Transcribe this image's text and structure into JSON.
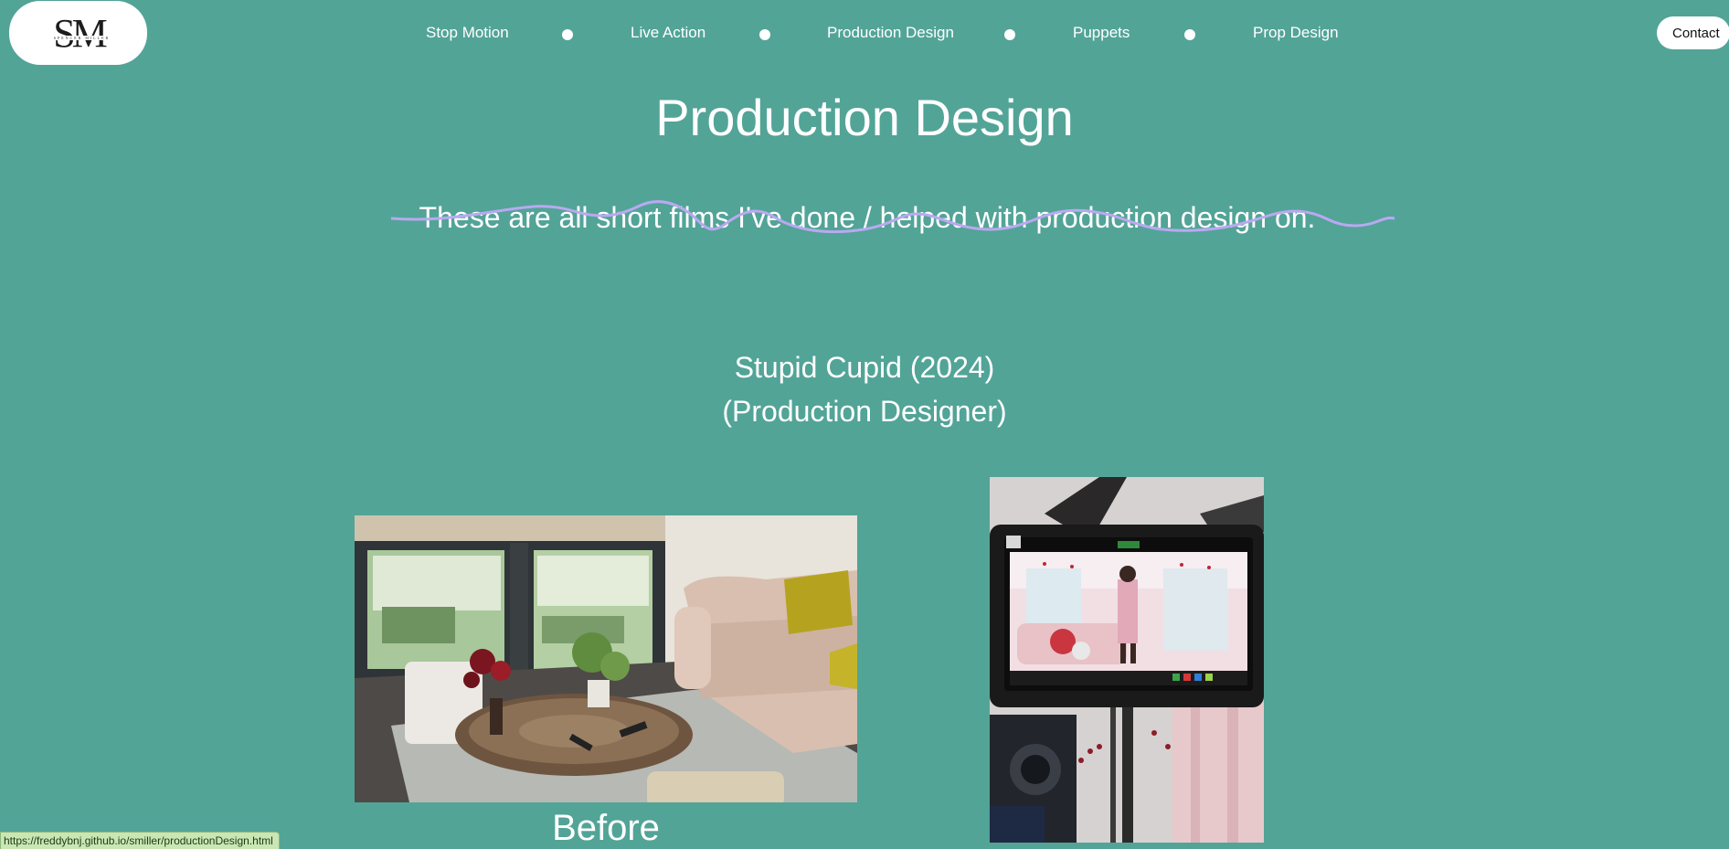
{
  "header": {
    "logo_text": "SM",
    "logo_subtext": "SPENCER MILLER",
    "nav": [
      {
        "label": "Stop Motion"
      },
      {
        "label": "Live Action"
      },
      {
        "label": "Production Design"
      },
      {
        "label": "Puppets"
      },
      {
        "label": "Prop Design"
      }
    ],
    "contact_label": "Contact"
  },
  "main": {
    "title": "Production Design",
    "subtitle": "These are all short films I've done / helped with production design on.",
    "film": {
      "title": "Stupid Cupid (2024)",
      "role": "(Production Designer)"
    },
    "images": [
      {
        "name": "living-room-before-photo",
        "caption": "Before"
      },
      {
        "name": "monitor-on-set-photo",
        "caption": ""
      }
    ]
  },
  "status_bar": {
    "url": "https://freddybnj.github.io/smiller/productionDesign.html"
  },
  "colors": {
    "background": "#52a497",
    "text": "#ffffff",
    "squiggle": "#b9a9f0",
    "button_bg": "#ffffff"
  }
}
